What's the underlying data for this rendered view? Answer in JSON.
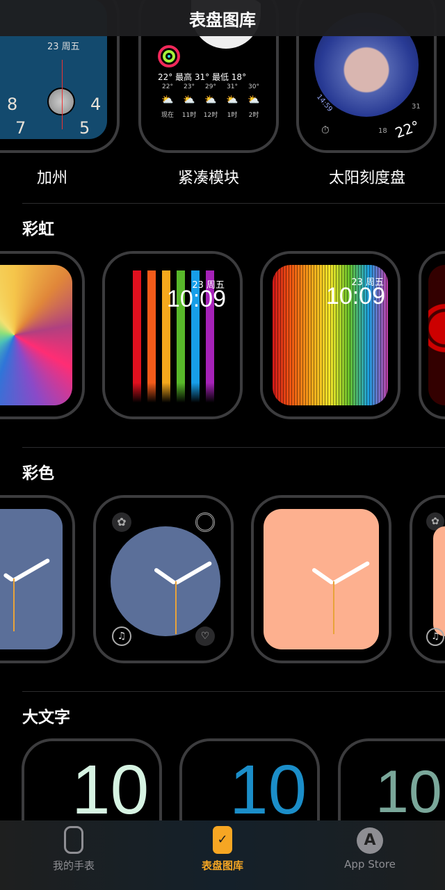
{
  "header": {
    "title": "表盘图库"
  },
  "featured": {
    "faces": [
      {
        "label": "加州",
        "date": "23 周五",
        "numerals": [
          "8",
          "4",
          "7",
          "5"
        ]
      },
      {
        "label": "紧凑模块",
        "weather_summary": "22° 最高 31° 最低 18°",
        "forecast": [
          {
            "temp": "22°",
            "time": "现在"
          },
          {
            "temp": "23°",
            "time": "11时"
          },
          {
            "temp": "29°",
            "time": "12时"
          },
          {
            "temp": "31°",
            "time": "1时"
          },
          {
            "temp": "30°",
            "time": "2时"
          }
        ]
      },
      {
        "label": "太阳刻度盘",
        "time_readout": "14:59",
        "temp": "22°",
        "range_low": "18",
        "range_high": "31"
      }
    ]
  },
  "sections": [
    {
      "title": "彩虹",
      "faces": [
        {
          "name": "rainbow-gradient"
        },
        {
          "date": "23 周五",
          "time": "10:09"
        },
        {
          "date": "23 周五",
          "time": "10:09"
        },
        {
          "name": "rainbow-circles"
        }
      ]
    },
    {
      "title": "彩色",
      "faces": [
        {
          "color": "#5b6f99"
        },
        {
          "color": "#5b6f99"
        },
        {
          "color": "#fdb08f"
        },
        {
          "color": "#fdb08f"
        }
      ]
    },
    {
      "title": "大文字",
      "faces": [
        {
          "text": "10",
          "color": "#d6f3e2"
        },
        {
          "text": "10",
          "color": "#1b8ec9"
        },
        {
          "text": "10",
          "color": "#7aa79a"
        }
      ]
    }
  ],
  "tabbar": {
    "items": [
      {
        "label": "我的手表",
        "icon": "watch-icon",
        "active": false
      },
      {
        "label": "表盘图库",
        "icon": "watch-face-icon",
        "active": true
      },
      {
        "label": "App Store",
        "icon": "app-store-icon",
        "active": false
      }
    ]
  },
  "colors": {
    "accent": "#f6a623",
    "inactive": "#8e8e93"
  }
}
